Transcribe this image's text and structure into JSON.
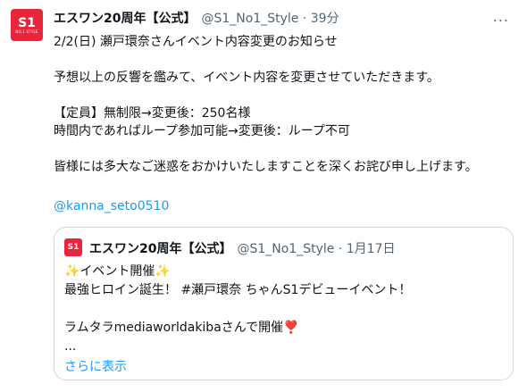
{
  "tweet": {
    "author_name": "エスワン20周年【公式】",
    "author_handle": "@S1_No1_Style",
    "separator": "·",
    "time": "39分",
    "more_icon": "...",
    "avatar": {
      "brand": "S1",
      "sub": "NO.1 STYLE",
      "color": "#e8253a"
    },
    "text": "2/2(日) 瀬戸環奈さんイベント内容変更のお知らせ\n\n予想以上の反響を鑑みて、イベント内容を変更させていただきます。\n\n【定員】無制限→変更後：250名様\n時間内であればループ参加可能→変更後：ループ不可\n\n皆様には多大なご迷惑をおかけいたしますことを深くお詫び申し上げます。",
    "mention": "@kanna_seto0510"
  },
  "quoted": {
    "author_name": "エスワン20周年【公式】",
    "author_handle": "@S1_No1_Style",
    "separator": "·",
    "date": "1月17日",
    "text": "✨イベント開催✨\n最強ヒロイン誕生！ #瀬戸環奈 ちゃんS1デビューイベント！\n\nラムタラmediaworldakibaさんで開催❣️\n...",
    "show_more": "さらに表示"
  },
  "colors": {
    "link": "#1d9bf0",
    "muted": "#536471",
    "border": "#cfd9de"
  }
}
